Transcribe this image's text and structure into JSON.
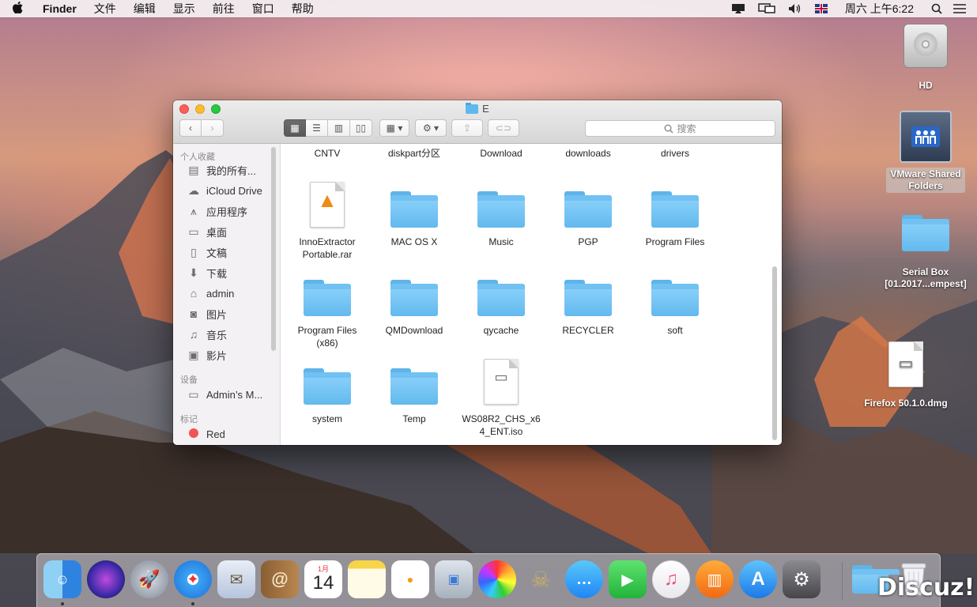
{
  "menubar": {
    "apple_icon": "",
    "app_name": "Finder",
    "items": [
      "文件",
      "编辑",
      "显示",
      "前往",
      "窗口",
      "帮助"
    ],
    "clock": "周六 上午6:22",
    "status_icons": [
      "airplay-icon",
      "display-icon",
      "volume-icon",
      "flag-uk-icon",
      "search-icon",
      "list-icon"
    ]
  },
  "desktop": {
    "icons": [
      {
        "label": "HD",
        "type": "harddisk"
      },
      {
        "label": "VMware Shared Folders",
        "type": "network-volume"
      },
      {
        "label": "Serial Box [01.2017...empest]",
        "type": "folder"
      },
      {
        "label": "Firefox 50.1.0.dmg",
        "type": "disk-image"
      }
    ]
  },
  "finder": {
    "title": "E",
    "search_placeholder": "搜索",
    "sidebar": {
      "favorites_header": "个人收藏",
      "favorites": [
        {
          "label": "我的所有...",
          "icon": "all-files-icon"
        },
        {
          "label": "iCloud Drive",
          "icon": "cloud-icon"
        },
        {
          "label": "应用程序",
          "icon": "applications-icon"
        },
        {
          "label": "桌面",
          "icon": "desktop-icon"
        },
        {
          "label": "文稿",
          "icon": "documents-icon"
        },
        {
          "label": "下载",
          "icon": "downloads-icon"
        },
        {
          "label": "admin",
          "icon": "home-icon"
        },
        {
          "label": "图片",
          "icon": "camera-icon"
        },
        {
          "label": "音乐",
          "icon": "music-icon"
        },
        {
          "label": "影片",
          "icon": "movies-icon"
        }
      ],
      "devices_header": "设备",
      "devices": [
        {
          "label": "Admin’s M...",
          "icon": "computer-icon"
        }
      ],
      "tags_header": "标记",
      "tags": [
        {
          "label": "Red",
          "color": "#f25555"
        }
      ]
    },
    "items": [
      {
        "name": "CNTV",
        "kind": "folder-partial"
      },
      {
        "name": "diskpart分区",
        "kind": "folder-partial"
      },
      {
        "name": "Download",
        "kind": "folder-partial"
      },
      {
        "name": "downloads",
        "kind": "folder-partial"
      },
      {
        "name": "drivers",
        "kind": "folder-partial"
      },
      {
        "name": "InnoExtractor Portable.rar",
        "kind": "rar"
      },
      {
        "name": "MAC OS X",
        "kind": "folder"
      },
      {
        "name": "Music",
        "kind": "folder"
      },
      {
        "name": "PGP",
        "kind": "folder"
      },
      {
        "name": "Program Files",
        "kind": "folder"
      },
      {
        "name": "Program Files (x86)",
        "kind": "folder"
      },
      {
        "name": "QMDownload",
        "kind": "folder"
      },
      {
        "name": "qycache",
        "kind": "folder"
      },
      {
        "name": "RECYCLER",
        "kind": "folder"
      },
      {
        "name": "soft",
        "kind": "folder"
      },
      {
        "name": "system",
        "kind": "folder"
      },
      {
        "name": "Temp",
        "kind": "folder"
      },
      {
        "name": "WS08R2_CHS_x64_ENT.iso",
        "kind": "iso"
      }
    ]
  },
  "dock": {
    "apps": [
      "finder",
      "siri",
      "launchpad",
      "safari",
      "mail",
      "contacts",
      "calendar",
      "notes",
      "reminders",
      "photo-booth",
      "photos",
      "game",
      "messages",
      "facetime",
      "itunes",
      "ibooks",
      "app-store",
      "system-preferences"
    ],
    "calendar_month": "1月",
    "calendar_day": "14",
    "watermark": "Discuz!"
  }
}
